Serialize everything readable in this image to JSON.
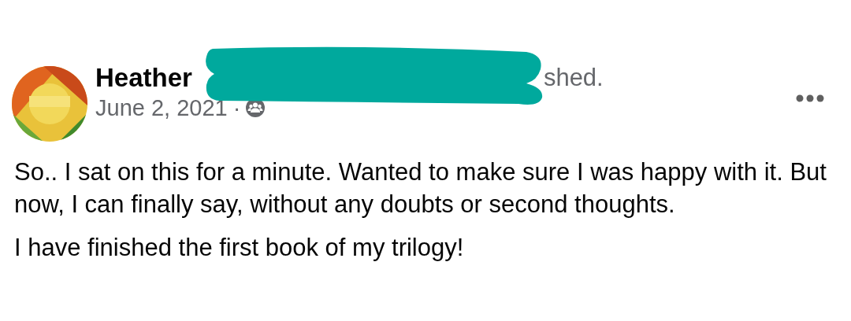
{
  "post": {
    "author": "Heather",
    "headline_tail": "shed.",
    "date": "June 2, 2021",
    "separator": "·",
    "paragraphs": [
      "So.. I sat on this for a minute. Wanted to make sure I was happy with it. But now, I can finally say, without any doubts or second thoughts.",
      "I have finished the first book of my trilogy!"
    ]
  }
}
